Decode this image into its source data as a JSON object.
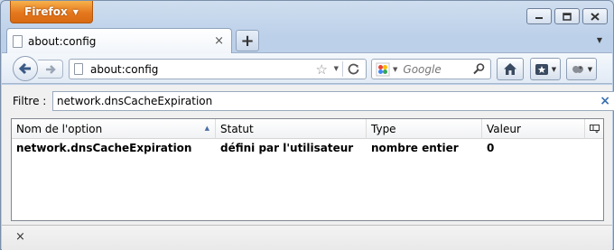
{
  "window": {
    "menu_button_label": "Firefox",
    "menu_button_arrow": "▼"
  },
  "tab": {
    "title": "about:config",
    "close_glyph": "×",
    "new_tab_glyph": "+",
    "tab_list_glyph": "▼"
  },
  "navbar": {
    "url": "about:config",
    "search_engine_icon": "google-icon",
    "search_placeholder": "Google"
  },
  "filter": {
    "label": "Filtre :",
    "value": "network.dnsCacheExpiration",
    "clear_glyph": "×"
  },
  "table": {
    "columns": [
      "Nom de l'option",
      "Statut",
      "Type",
      "Valeur"
    ],
    "sort_indicator": "▲",
    "rows": [
      {
        "name": "network.dnsCacheExpiration",
        "status": "défini par l'utilisateur",
        "type": "nombre entier",
        "value": "0"
      }
    ]
  },
  "statusbar": {
    "close_glyph": "×"
  },
  "colors": {
    "firefox_orange": "#e5781e",
    "chrome_blue": "#c9d9ed"
  }
}
